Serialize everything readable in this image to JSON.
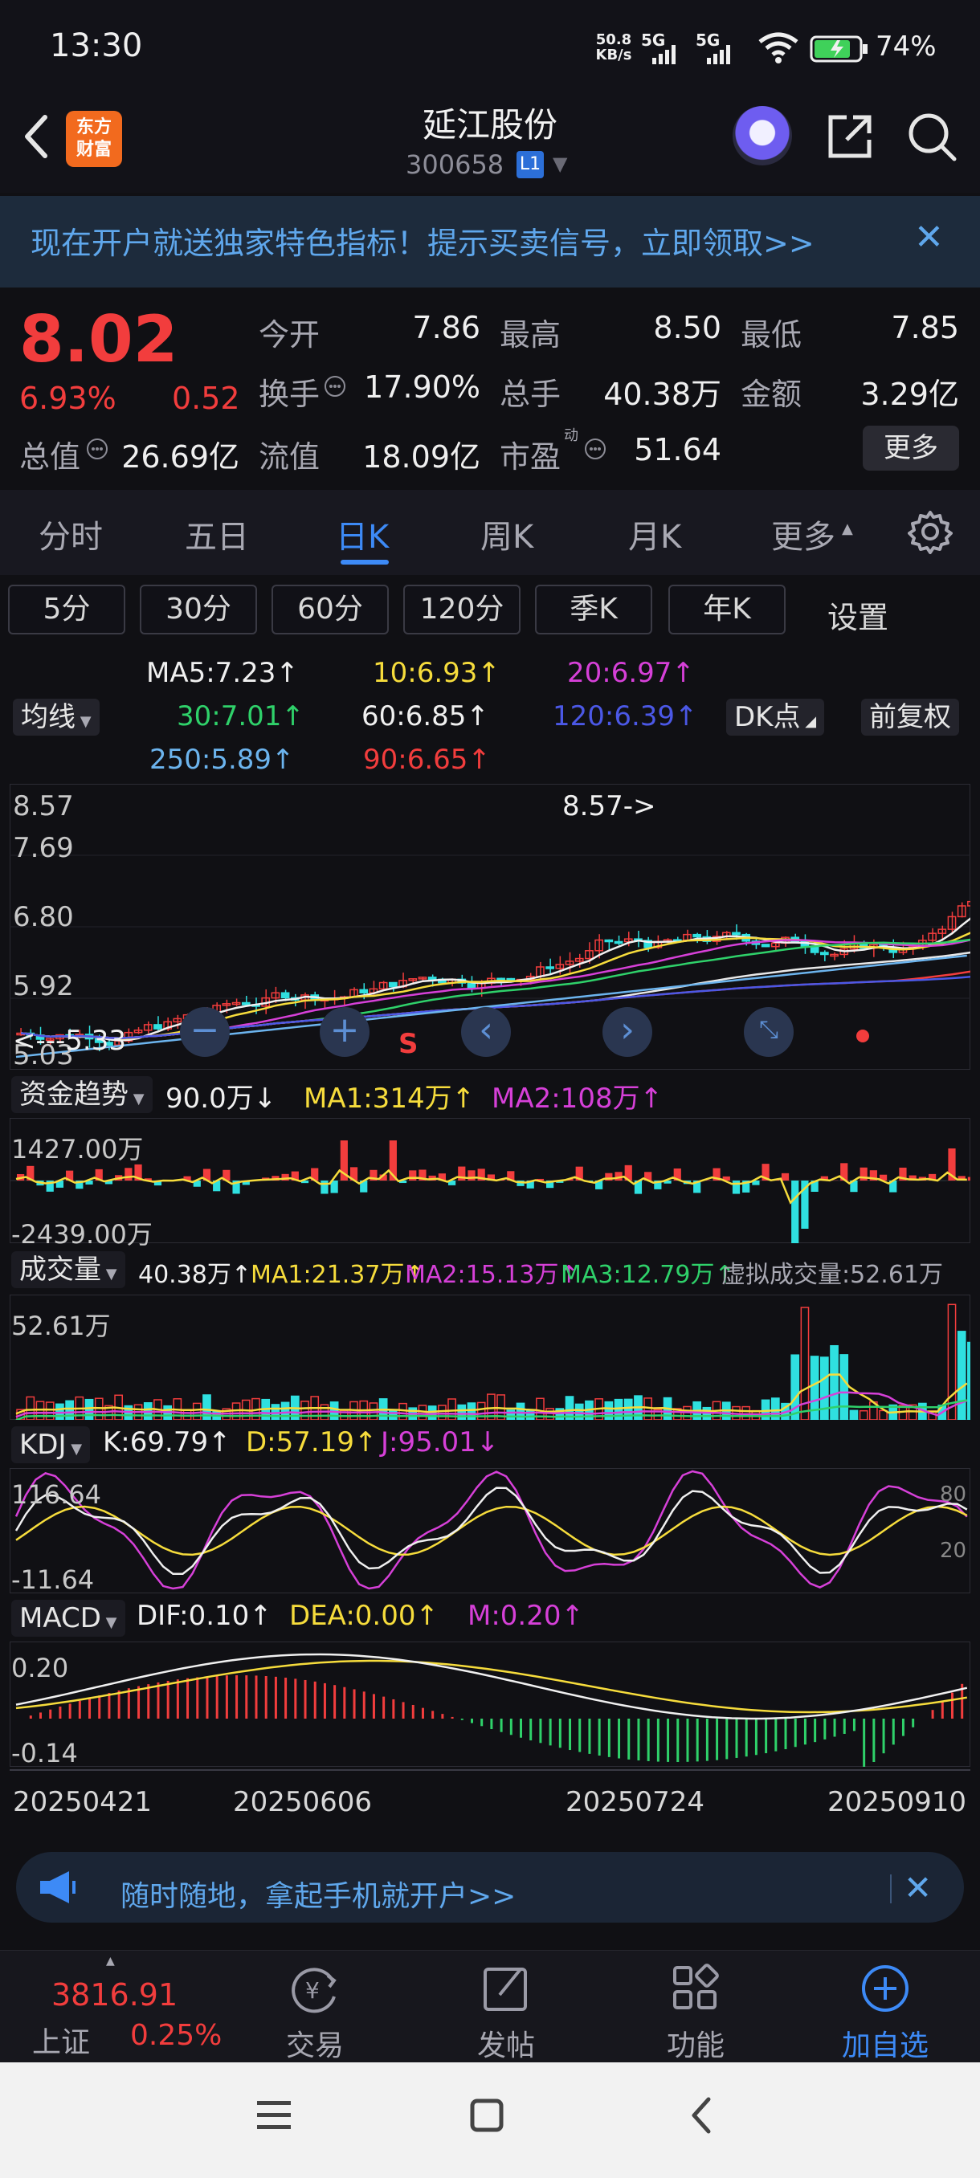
{
  "status_bar": {
    "time": "13:30",
    "net_speed": "50.8\nKB/s",
    "signal1": "5G",
    "signal2": "5G",
    "battery": "74%"
  },
  "header": {
    "logo": "东方\n财富",
    "title": "延江股份",
    "code": "300658",
    "level": "L1"
  },
  "promo": {
    "text": "现在开户就送独家特色指标！提示买卖信号，立即领取>>"
  },
  "quote": {
    "price": "8.02",
    "pct": "6.93%",
    "chg": "0.52",
    "open_label": "今开",
    "open": "7.86",
    "high_label": "最高",
    "high": "8.50",
    "low_label": "最低",
    "low": "7.85",
    "turnover_label": "换手",
    "turnover": "17.90%",
    "volume_label": "总手",
    "volume": "40.38万",
    "amount_label": "金额",
    "amount": "3.29亿",
    "mktcap_label": "总值",
    "mktcap": "26.69亿",
    "float_label": "流值",
    "float": "18.09亿",
    "pe_label": "市盈",
    "pe": "51.64",
    "more": "更多"
  },
  "tabs": [
    "分时",
    "五日",
    "日K",
    "周K",
    "月K",
    "更多"
  ],
  "periods": [
    "5分",
    "30分",
    "60分",
    "120分",
    "季K",
    "年K",
    "设置"
  ],
  "ma_legend": {
    "ma5": "MA5:7.23↑",
    "ma10": "10:6.93↑",
    "ma20": "20:6.97↑",
    "ma30": "30:7.01↑",
    "ma60": "60:6.85↑",
    "ma120": "120:6.39↑",
    "ma250": "250:5.89↑",
    "ma90": "90:6.65↑",
    "junxian": "均线",
    "dk": "DK点",
    "fq": "前复权"
  },
  "kline": {
    "y_labels": [
      "8.57",
      "7.69",
      "6.80",
      "5.92",
      "5.03"
    ],
    "high_marker": "8.57->",
    "low_marker": "<---5.33",
    "s_marker": "S"
  },
  "fund": {
    "name": "资金趋势",
    "value": "90.0万↓",
    "ma1": "MA1:314万↑",
    "ma2": "MA2:108万↑",
    "ymax": "1427.00万",
    "ymin": "-2439.00万"
  },
  "vol": {
    "name": "成交量",
    "value": "40.38万↑",
    "ma1": "MA1:21.37万↑",
    "ma2": "MA2:15.13万↑",
    "ma3": "MA3:12.79万↑",
    "virtual": "虚拟成交量:52.61万",
    "ymax": "52.61万"
  },
  "kdj": {
    "name": "KDJ",
    "k": "K:69.79↑",
    "d": "D:57.19↑",
    "j": "J:95.01↓",
    "ymax": "116.64",
    "ymin": "-11.64",
    "r80": "80",
    "r20": "20"
  },
  "macd": {
    "name": "MACD",
    "dif": "DIF:0.10↑",
    "dea": "DEA:0.00↑",
    "m": "M:0.20↑",
    "ymax": "0.20",
    "ymin": "-0.14"
  },
  "dates": [
    "20250421",
    "20250606",
    "20250724",
    "20250910"
  ],
  "bottom_banner": {
    "text": "随时随地，拿起手机就开户>>"
  },
  "bottom_nav": {
    "index_value": "3816.91",
    "index_name": "上证",
    "index_pct": "0.25%",
    "trade": "交易",
    "post": "发帖",
    "func": "功能",
    "add": "加自选"
  },
  "colors": {
    "up": "#f23d3d",
    "down": "#2fd16a",
    "accent": "#3d8af6"
  }
}
